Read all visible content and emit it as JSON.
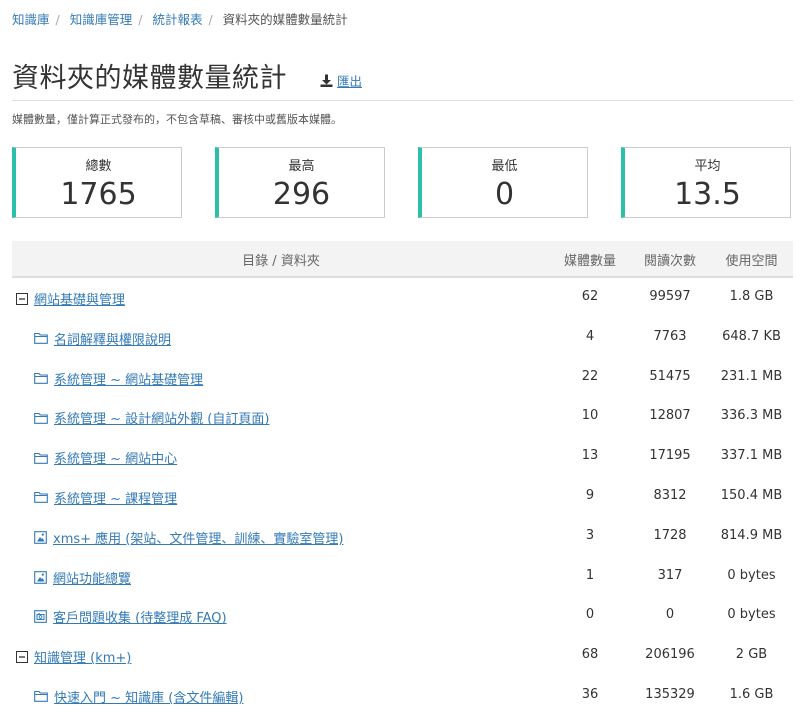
{
  "breadcrumb": [
    "知識庫",
    "知識庫管理",
    "統計報表",
    "資料夾的媒體數量統計"
  ],
  "page_title": "資料夾的媒體數量統計",
  "export_label": "匯出",
  "note": "媒體數量，僅計算正式發布的，不包含草稿、審核中或舊版本媒體。",
  "stats": [
    {
      "label": "總數",
      "value": "1765"
    },
    {
      "label": "最高",
      "value": "296"
    },
    {
      "label": "最低",
      "value": "0"
    },
    {
      "label": "平均",
      "value": "13.5"
    }
  ],
  "accent_color": "#2cbfa9",
  "link_color": "#337ab7",
  "table": {
    "headers": {
      "name": "目錄 / 資料夾",
      "count": "媒體數量",
      "reads": "閱讀次數",
      "space": "使用空間"
    },
    "rows": [
      {
        "icon": "minus-square-icon",
        "name": "網站基礎與管理",
        "count": "62",
        "reads": "99597",
        "space": "1.8 GB"
      },
      {
        "icon": "folder-icon",
        "name": "名詞解釋與權限說明",
        "count": "4",
        "reads": "7763",
        "space": "648.7 KB"
      },
      {
        "icon": "folder-icon",
        "name": "系統管理 ~ 網站基礎管理",
        "count": "22",
        "reads": "51475",
        "space": "231.1 MB"
      },
      {
        "icon": "folder-icon",
        "name": "系統管理 ~ 設計網站外觀 (自訂頁面)",
        "count": "10",
        "reads": "12807",
        "space": "336.3 MB"
      },
      {
        "icon": "folder-icon",
        "name": "系統管理 ~ 網站中心",
        "count": "13",
        "reads": "17195",
        "space": "337.1 MB"
      },
      {
        "icon": "folder-icon",
        "name": "系統管理 ~ 課程管理",
        "count": "9",
        "reads": "8312",
        "space": "150.4 MB"
      },
      {
        "icon": "image-folder-icon",
        "name": "xms+ 應用 (架站、文件管理、訓練、實驗室管理)",
        "count": "3",
        "reads": "1728",
        "space": "814.9 MB"
      },
      {
        "icon": "image-folder-icon",
        "name": "網站功能總覽",
        "count": "1",
        "reads": "317",
        "space": "0 bytes"
      },
      {
        "icon": "camera-folder-icon",
        "name": "客戶問題收集 (待整理成 FAQ)",
        "count": "0",
        "reads": "0",
        "space": "0 bytes"
      },
      {
        "icon": "minus-square-icon",
        "name": "知識管理 (km+)",
        "count": "68",
        "reads": "206196",
        "space": "2 GB"
      },
      {
        "icon": "folder-icon",
        "name": "快速入門 ~ 知識庫 (含文件編輯)",
        "count": "36",
        "reads": "135329",
        "space": "1.6 GB"
      }
    ]
  }
}
